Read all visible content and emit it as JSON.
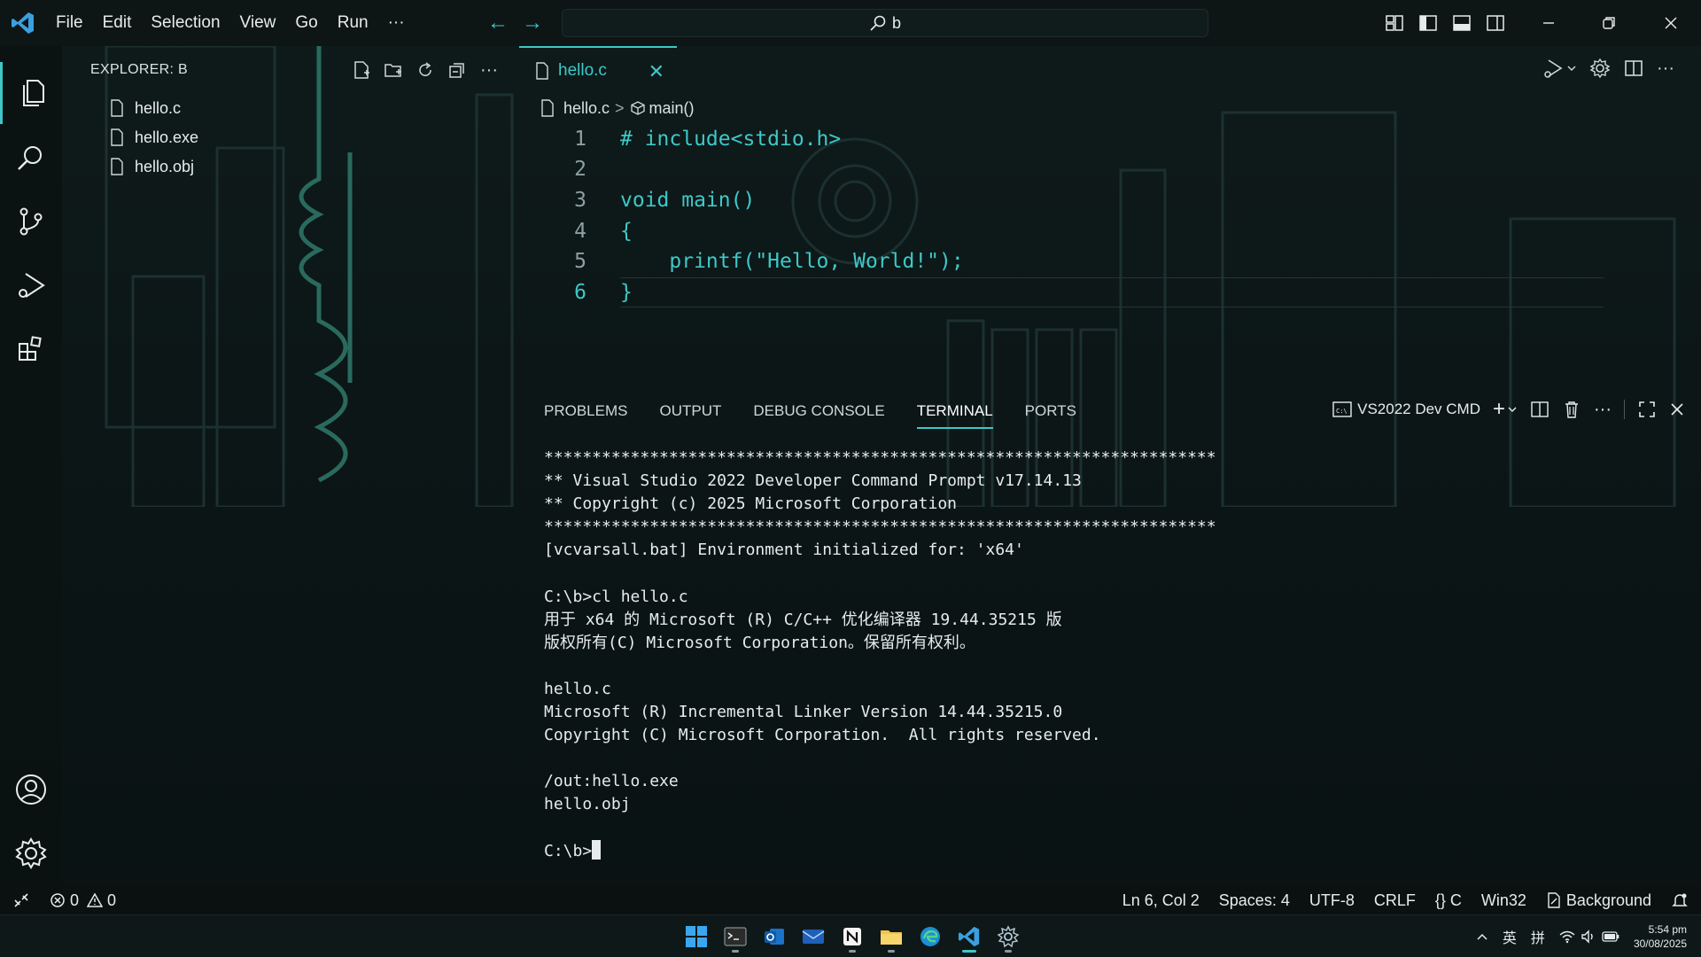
{
  "menu": {
    "items": [
      "File",
      "Edit",
      "Selection",
      "View",
      "Go",
      "Run",
      "···"
    ]
  },
  "search": {
    "value": "b"
  },
  "explorer": {
    "title": "EXPLORER: B",
    "files": [
      "hello.c",
      "hello.exe",
      "hello.obj"
    ]
  },
  "editor": {
    "tab": {
      "label": "hello.c",
      "close": "✕"
    },
    "breadcrumb": {
      "file": "hello.c",
      "sep": ">",
      "symbol": "main()"
    },
    "lines": [
      {
        "num": "1",
        "text": "# include<stdio.h>"
      },
      {
        "num": "2",
        "text": ""
      },
      {
        "num": "3",
        "text": "void main()"
      },
      {
        "num": "4",
        "text": "{"
      },
      {
        "num": "5",
        "text": "    printf(\"Hello, World!\");"
      },
      {
        "num": "6",
        "text": "}"
      }
    ]
  },
  "panel": {
    "tabs": [
      "PROBLEMS",
      "OUTPUT",
      "DEBUG CONSOLE",
      "TERMINAL",
      "PORTS"
    ],
    "active_tab": "TERMINAL",
    "terminal_name": "VS2022 Dev CMD",
    "terminal_lines": [
      "**********************************************************************",
      "** Visual Studio 2022 Developer Command Prompt v17.14.13",
      "** Copyright (c) 2025 Microsoft Corporation",
      "**********************************************************************",
      "[vcvarsall.bat] Environment initialized for: 'x64'",
      "",
      "C:\\b>cl hello.c",
      "用于 x64 的 Microsoft (R) C/C++ 优化编译器 19.44.35215 版",
      "版权所有(C) Microsoft Corporation。保留所有权利。",
      "",
      "hello.c",
      "Microsoft (R) Incremental Linker Version 14.44.35215.0",
      "Copyright (C) Microsoft Corporation.  All rights reserved.",
      "",
      "/out:hello.exe",
      "hello.obj",
      ""
    ],
    "prompt": "C:\\b>"
  },
  "status": {
    "errors": "0",
    "warnings": "0",
    "position": "Ln 6, Col 2",
    "spaces": "Spaces: 4",
    "encoding": "UTF-8",
    "eol": "CRLF",
    "lang_braces": "{}",
    "language": "C",
    "platform": "Win32",
    "background": "Background"
  },
  "taskbar": {
    "tray_ime1": "英",
    "tray_ime2": "拼",
    "time": "5:54 pm",
    "date": "30/08/2025"
  },
  "colors": {
    "accent": "#3ec8c8",
    "background": "#0c1616"
  }
}
